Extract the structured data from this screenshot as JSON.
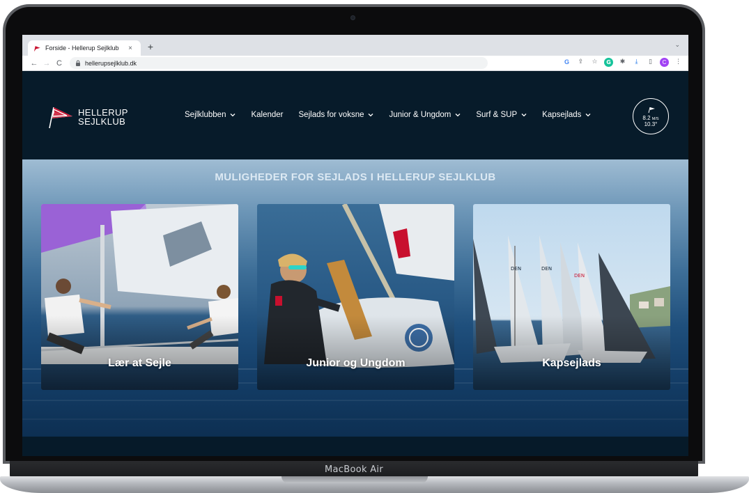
{
  "browser": {
    "tab_title": "Forside - Hellerup Sejlklub",
    "tab_close": "×",
    "new_tab": "+",
    "tab_menu": "⌄",
    "url": "hellerupsejlklub.dk",
    "nav": {
      "back": "←",
      "forward": "→",
      "reload": "C"
    },
    "extensions": [
      "G",
      "⇪",
      "☆",
      "G",
      "✱",
      "⤓",
      "▯",
      "C",
      "⋮"
    ]
  },
  "site": {
    "logo": {
      "line1": "HELLERUP",
      "line2": "SEJLKLUB"
    },
    "nav_items": [
      {
        "label": "Sejlklubben",
        "dropdown": true
      },
      {
        "label": "Kalender",
        "dropdown": false
      },
      {
        "label": "Sejlads for voksne",
        "dropdown": true
      },
      {
        "label": "Junior & Ungdom",
        "dropdown": true
      },
      {
        "label": "Surf & SUP",
        "dropdown": true
      },
      {
        "label": "Kapsejlads",
        "dropdown": true
      }
    ],
    "weather": {
      "wind": "8.2",
      "wind_unit": "M/S",
      "temp": "10.3°"
    },
    "hero_title": "MULIGHEDER FOR SEJLADS I HELLERUP SEJLKLUB",
    "cards": [
      {
        "label": "Lær at Sejle"
      },
      {
        "label": "Junior og Ungdom"
      },
      {
        "label": "Kapsejlads"
      }
    ]
  },
  "device": {
    "brand": "MacBook Air"
  },
  "colors": {
    "header_bg": "#071b2a",
    "accent_red": "#c8102e",
    "hero_top": "#9fbcd3",
    "hero_bottom": "#0d2f52"
  }
}
